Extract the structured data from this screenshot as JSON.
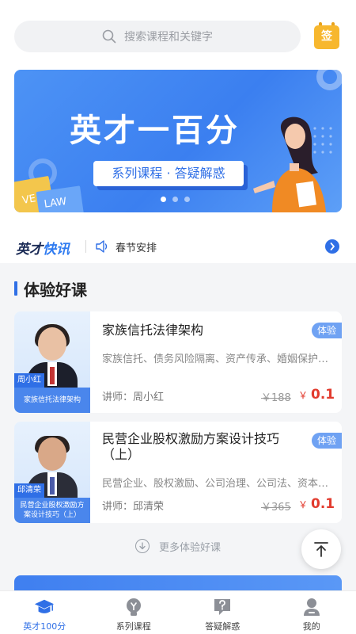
{
  "search": {
    "placeholder": "搜索课程和关键字"
  },
  "sign_button": {
    "label": "签"
  },
  "banner": {
    "title": "英才一百分",
    "subtitle": "系列课程 · 答疑解惑",
    "book_left": "VE",
    "book_right": "LAW",
    "page_count": 3,
    "active_page": 1
  },
  "news": {
    "logo_main": "英才",
    "logo_accent": "快讯",
    "text": "春节安排"
  },
  "section": {
    "title": "体验好课"
  },
  "courses": [
    {
      "title": "家族信托法律架构",
      "tags": "家族信托、债务风险隔离、资产传承、婚姻保护…",
      "teacher": "讲师：周小红",
      "price_old": "￥188",
      "currency": "￥",
      "price_new": "0.1",
      "badge": "体验",
      "thumb_name": "周小红",
      "thumb_caption": "家族信托法律架构"
    },
    {
      "title": "民营企业股权激励方案设计技巧（上）",
      "tags": "民营企业、股权激励、公司治理、公司法、资本…",
      "teacher": "讲师：邱清荣",
      "price_old": "￥365",
      "currency": "￥",
      "price_new": "0.1",
      "badge": "体验",
      "thumb_name": "邱清荣",
      "thumb_caption": "民营企业股权激励方案设计技巧（上）"
    }
  ],
  "more": {
    "label": "更多体验好课"
  },
  "tabs": [
    {
      "label": "英才100分",
      "icon": "graduation-cap-icon",
      "active": true
    },
    {
      "label": "系列课程",
      "icon": "lightbulb-icon",
      "active": false
    },
    {
      "label": "答疑解惑",
      "icon": "question-icon",
      "active": false
    },
    {
      "label": "我的",
      "icon": "user-icon",
      "active": false
    }
  ],
  "colors": {
    "primary": "#2f6fe6",
    "price": "#e23b2e",
    "sign": "#f7b72e"
  }
}
